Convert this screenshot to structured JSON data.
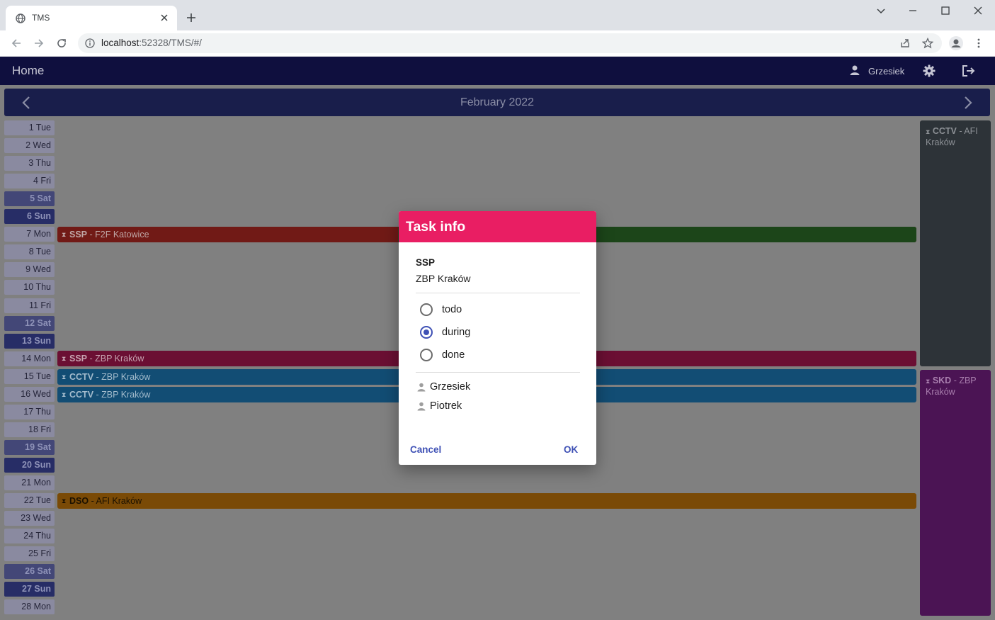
{
  "browser": {
    "tab_title": "TMS",
    "url_host": "localhost",
    "url_rest": ":52328/TMS/#/"
  },
  "appbar": {
    "title": "Home",
    "user": "Grzesiek"
  },
  "calendar": {
    "month_label": "February 2022",
    "days": [
      {
        "label": "1 Tue",
        "type": "weekday"
      },
      {
        "label": "2 Wed",
        "type": "weekday"
      },
      {
        "label": "3 Thu",
        "type": "weekday"
      },
      {
        "label": "4 Fri",
        "type": "weekday"
      },
      {
        "label": "5 Sat",
        "type": "sat"
      },
      {
        "label": "6 Sun",
        "type": "sun"
      },
      {
        "label": "7 Mon",
        "type": "weekday"
      },
      {
        "label": "8 Tue",
        "type": "weekday"
      },
      {
        "label": "9 Wed",
        "type": "weekday"
      },
      {
        "label": "10 Thu",
        "type": "weekday"
      },
      {
        "label": "11 Fri",
        "type": "weekday"
      },
      {
        "label": "12 Sat",
        "type": "sat"
      },
      {
        "label": "13 Sun",
        "type": "sun"
      },
      {
        "label": "14 Mon",
        "type": "weekday"
      },
      {
        "label": "15 Tue",
        "type": "weekday"
      },
      {
        "label": "16 Wed",
        "type": "weekday"
      },
      {
        "label": "17 Thu",
        "type": "weekday"
      },
      {
        "label": "18 Fri",
        "type": "weekday"
      },
      {
        "label": "19 Sat",
        "type": "sat"
      },
      {
        "label": "20 Sun",
        "type": "sun"
      },
      {
        "label": "21 Mon",
        "type": "weekday"
      },
      {
        "label": "22 Tue",
        "type": "weekday"
      },
      {
        "label": "23 Wed",
        "type": "weekday"
      },
      {
        "label": "24 Thu",
        "type": "weekday"
      },
      {
        "label": "25 Fri",
        "type": "weekday"
      },
      {
        "label": "26 Sat",
        "type": "sat"
      },
      {
        "label": "27 Sun",
        "type": "sun"
      },
      {
        "label": "28 Mon",
        "type": "weekday"
      }
    ],
    "tasks": [
      {
        "code": "SSP",
        "place": " - F2F Katowice",
        "day": "7 Mon"
      },
      {
        "code": "SSP",
        "place": " - ZBP Kraków",
        "day": "14 Mon"
      },
      {
        "code": "CCTV",
        "place": " - ZBP Kraków",
        "day": "15 Tue"
      },
      {
        "code": "CCTV",
        "place": " - ZBP Kraków",
        "day": "16 Wed"
      },
      {
        "code": "DSO",
        "place": " - AFI Kraków",
        "day": "22 Tue"
      }
    ],
    "side_tasks": [
      {
        "code": "CCTV",
        "place": " - AFI Kraków"
      },
      {
        "code": "SKD",
        "place": " - ZBP Kraków"
      }
    ]
  },
  "dialog": {
    "title": "Task info",
    "task_type": "SSP",
    "task_place": "ZBP Kraków",
    "status_options": [
      "todo",
      "during",
      "done"
    ],
    "selected_status": "during",
    "assignees": [
      "Grzesiek",
      "Piotrek"
    ],
    "cancel_label": "Cancel",
    "ok_label": "OK"
  },
  "colors": {
    "dialog_header": "#e91e63",
    "accent": "#3f51b5",
    "appbar": "#0f0f3e"
  }
}
